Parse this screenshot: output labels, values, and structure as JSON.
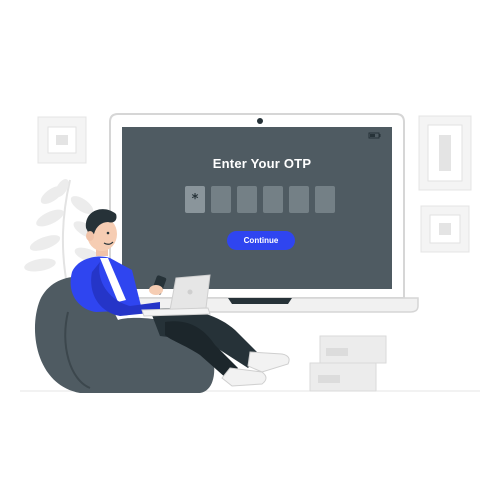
{
  "otp_screen": {
    "title": "Enter Your OTP",
    "digits": [
      "*",
      "",
      "",
      "",
      "",
      ""
    ],
    "continue_label": "Continue"
  },
  "colors": {
    "accent": "#2f45f0",
    "screen": "#4f5b62",
    "shirt": "#2f45f0",
    "beanbag": "#4f5b62"
  },
  "icons": [
    "battery-icon",
    "camera-icon",
    "plant-icon",
    "picture-frame-icon"
  ]
}
